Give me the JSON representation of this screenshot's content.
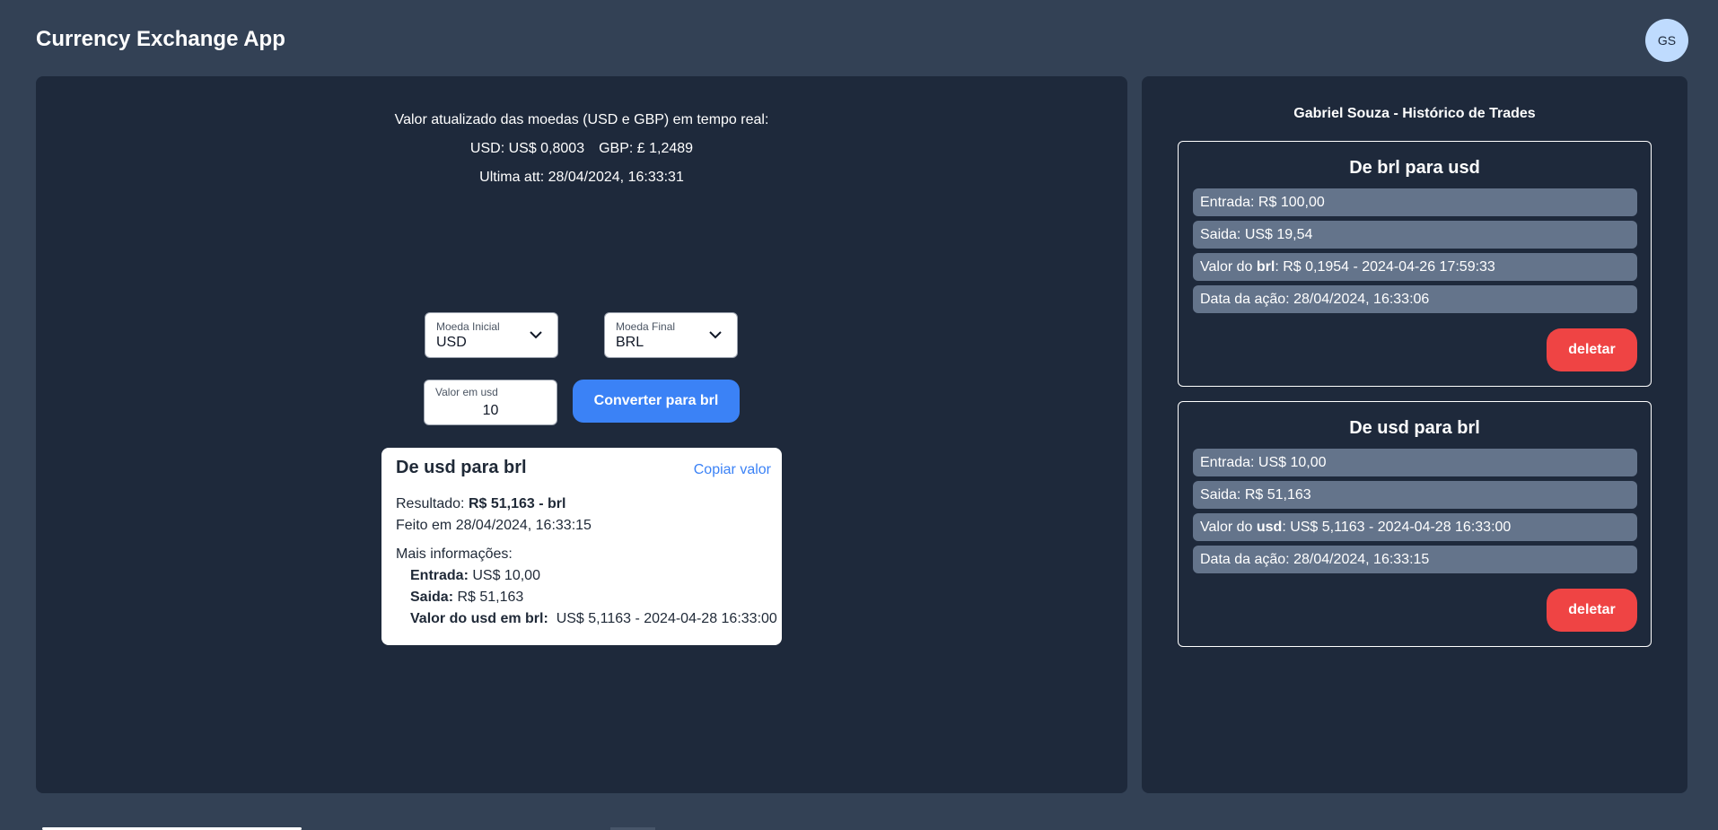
{
  "header": {
    "app_title": "Currency Exchange App",
    "avatar_initials": "GS"
  },
  "rates": {
    "headline": "Valor atualizado das moedas (USD e GBP) em tempo real:",
    "usd": "USD: US$ 0,8003",
    "gbp": "GBP: £ 1,2489",
    "last_update": "Ultima att: 28/04/2024, 16:33:31"
  },
  "converter": {
    "initial_label": "Moeda Inicial",
    "initial_value": "USD",
    "final_label": "Moeda Final",
    "final_value": "BRL",
    "amount_label": "Valor em usd",
    "amount_value": "10",
    "convert_label": "Converter para brl"
  },
  "result": {
    "title": "De usd para brl",
    "copy_label": "Copiar valor",
    "result_label": "Resultado:",
    "result_value": "R$ 51,163 - brl",
    "done_at": "Feito em 28/04/2024, 16:33:15",
    "more_info": "Mais informações:",
    "entrada_label": "Entrada:",
    "entrada_value": "US$ 10,00",
    "saida_label": "Saida:",
    "saida_value": "R$ 51,163",
    "rate_label": "Valor do usd em brl:",
    "rate_value": "US$ 5,1163 - 2024-04-28 16:33:00"
  },
  "history": {
    "title": "Gabriel Souza - Histórico de Trades",
    "trades": [
      {
        "title": "De brl para usd",
        "entrada": "Entrada: R$ 100,00",
        "saida": "Saida: US$ 19,54",
        "valor_prefix": "Valor do ",
        "valor_currency": "brl",
        "valor_suffix": ": R$ 0,1954 - 2024-04-26 17:59:33",
        "data": "Data da ação: 28/04/2024, 16:33:06",
        "delete_label": "deletar"
      },
      {
        "title": "De usd para brl",
        "entrada": "Entrada: US$ 10,00",
        "saida": "Saida: R$ 51,163",
        "valor_prefix": "Valor do ",
        "valor_currency": "usd",
        "valor_suffix": ": US$ 5,1163 - 2024-04-28 16:33:00",
        "data": "Data da ação: 28/04/2024, 16:33:15",
        "delete_label": "deletar"
      }
    ]
  },
  "icons": {
    "select_chevron": "chevron-down-icon"
  },
  "colors": {
    "background": "#334155",
    "panel": "#1e293b",
    "primary_button": "#3b82f6",
    "delete_button": "#ef4444",
    "history_row": "#64748b",
    "avatar": "#bfdbfe"
  }
}
